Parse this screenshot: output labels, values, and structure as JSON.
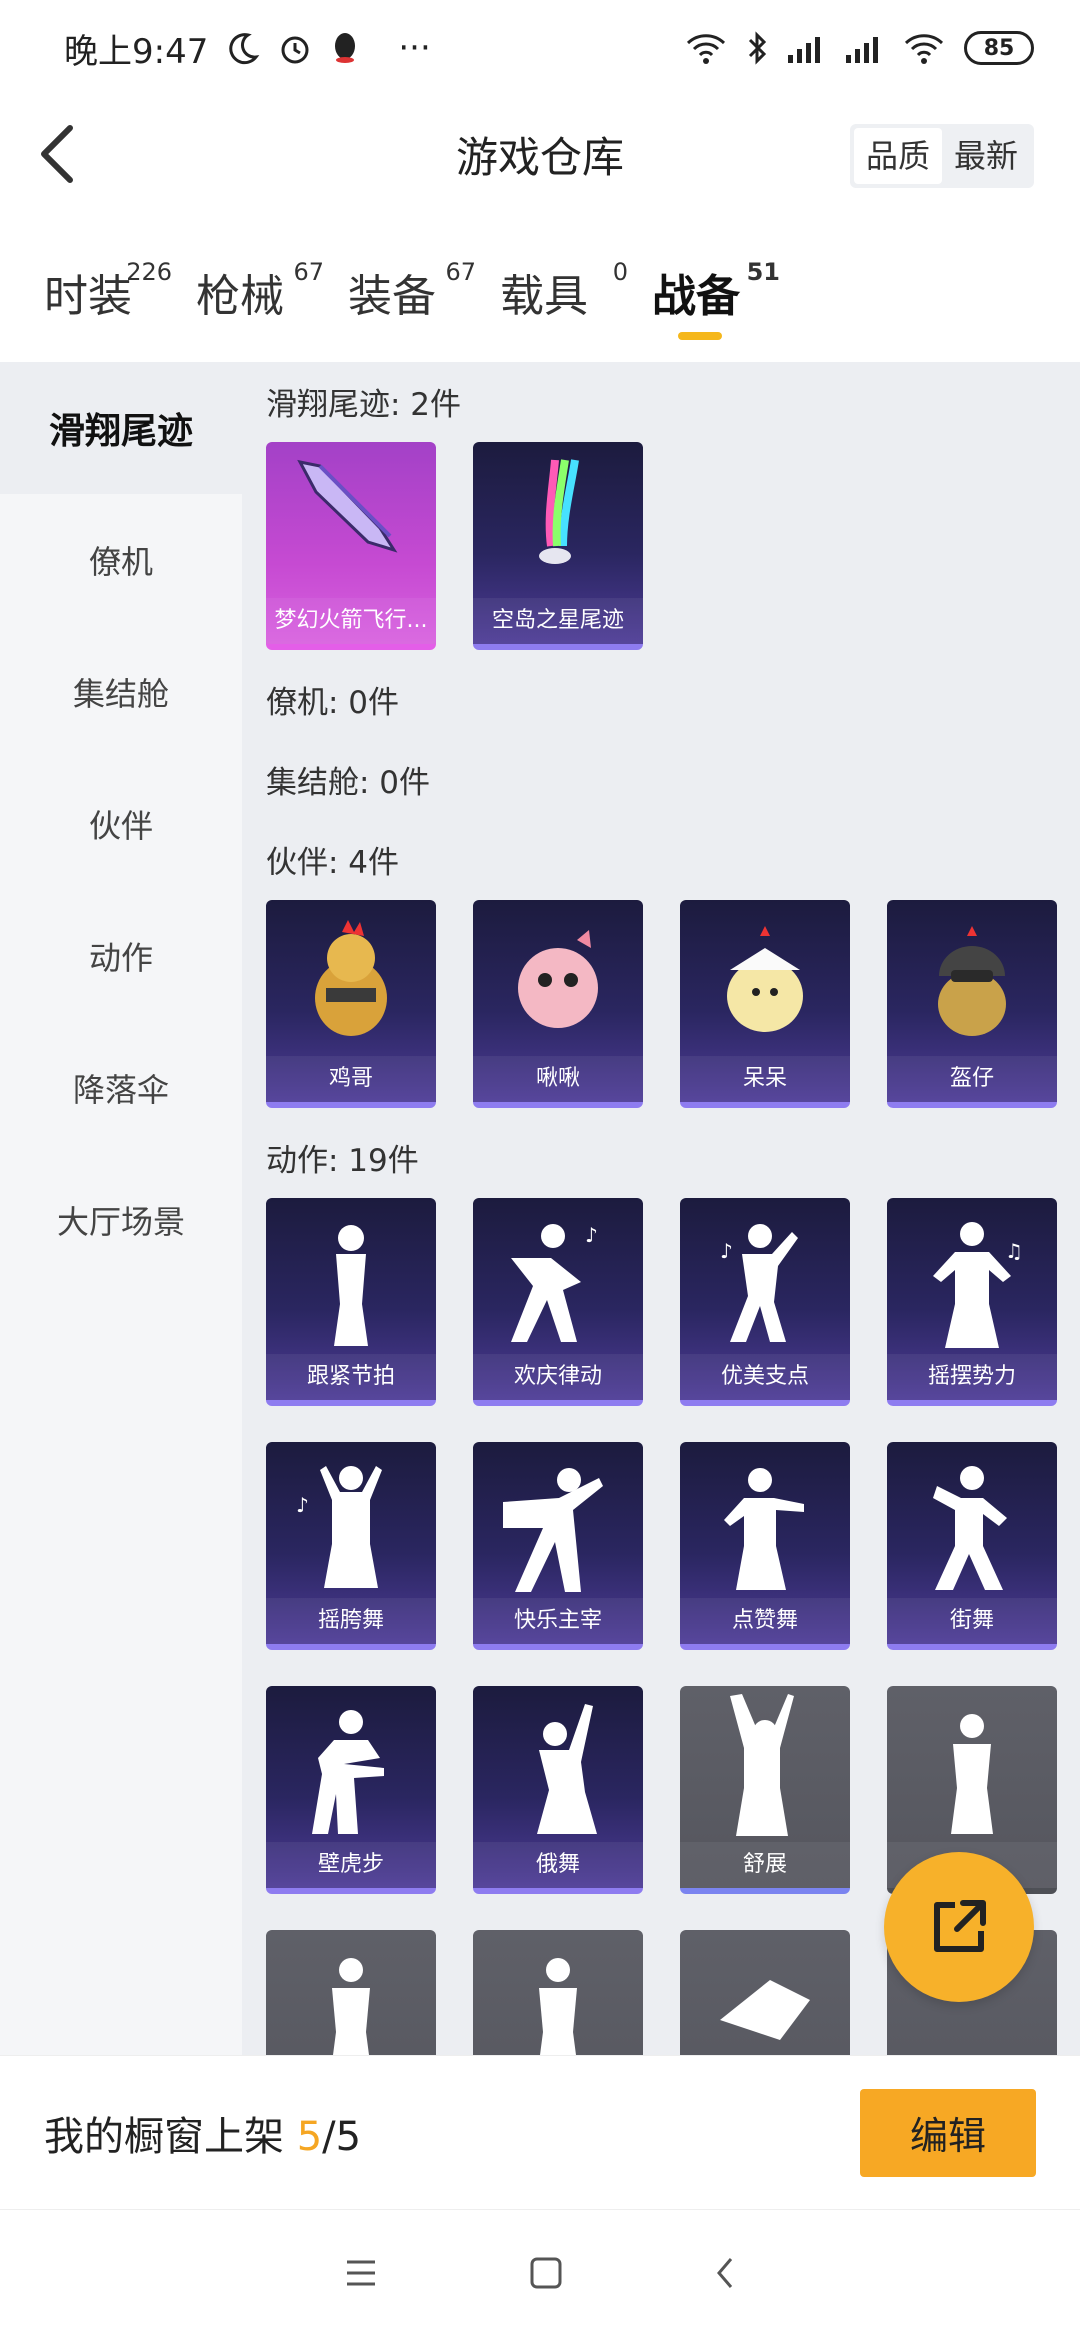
{
  "status_bar": {
    "time": "晚上9:47",
    "dots": "···",
    "battery": "85"
  },
  "header": {
    "title": "游戏仓库",
    "sort_quality": "品质",
    "sort_newest": "最新"
  },
  "tabs": [
    {
      "label": "时装",
      "count": "226"
    },
    {
      "label": "枪械",
      "count": "67"
    },
    {
      "label": "装备",
      "count": "67"
    },
    {
      "label": "载具",
      "count": "0"
    },
    {
      "label": "战备",
      "count": "51"
    }
  ],
  "sidebar": [
    {
      "label": "滑翔尾迹"
    },
    {
      "label": "僚机"
    },
    {
      "label": "集结舱"
    },
    {
      "label": "伙伴"
    },
    {
      "label": "动作"
    },
    {
      "label": "降落伞"
    },
    {
      "label": "大厅场景"
    }
  ],
  "sections": {
    "trail": {
      "title": "滑翔尾迹: 2件",
      "items": [
        {
          "name": "梦幻火箭飞行..."
        },
        {
          "name": "空岛之星尾迹"
        }
      ]
    },
    "wingman": {
      "title": "僚机: 0件"
    },
    "pod": {
      "title": "集结舱: 0件"
    },
    "companion": {
      "title": "伙伴: 4件",
      "items": [
        {
          "name": "鸡哥"
        },
        {
          "name": "啾啾"
        },
        {
          "name": "呆呆"
        },
        {
          "name": "盔仔"
        }
      ]
    },
    "emote": {
      "title": "动作: 19件",
      "items": [
        {
          "name": "跟紧节拍"
        },
        {
          "name": "欢庆律动"
        },
        {
          "name": "优美支点"
        },
        {
          "name": "摇摆势力"
        },
        {
          "name": "摇胯舞"
        },
        {
          "name": "快乐主宰"
        },
        {
          "name": "点赞舞"
        },
        {
          "name": "街舞"
        },
        {
          "name": "壁虎步"
        },
        {
          "name": "俄舞"
        },
        {
          "name": "舒展"
        },
        {
          "name": ""
        }
      ]
    }
  },
  "shelf": {
    "label": "我的橱窗上架",
    "current": "5",
    "separator": "/",
    "max": "5",
    "edit_button": "编辑"
  },
  "colors": {
    "accent": "#f7a824",
    "tab_indicator": "#f5b71b",
    "card_purple": "#2a2660",
    "card_pink": "#c64ad2",
    "card_gray": "#5f6068"
  }
}
